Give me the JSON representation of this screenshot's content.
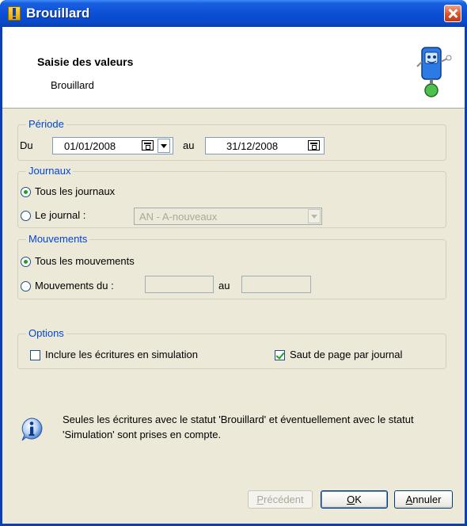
{
  "window": {
    "title": "Brouillard"
  },
  "header": {
    "title": "Saisie des valeurs",
    "subtitle": "Brouillard"
  },
  "periode": {
    "legend": "Période",
    "from_label": "Du",
    "from_value": "01/01/2008",
    "to_label": "au",
    "to_value": "31/12/2008"
  },
  "journaux": {
    "legend": "Journaux",
    "option_all": "Tous les journaux",
    "option_one": "Le journal :",
    "journal_value": "AN - A-nouveaux",
    "selected": "all"
  },
  "mouvements": {
    "legend": "Mouvements",
    "option_all": "Tous les mouvements",
    "option_range": "Mouvements du :",
    "to_label": "au",
    "from_value": "",
    "to_value": "",
    "selected": "all"
  },
  "options": {
    "legend": "Options",
    "include_simulation": "Inclure les écritures en simulation",
    "include_simulation_checked": false,
    "page_break": "Saut de page par journal",
    "page_break_checked": true
  },
  "info": {
    "text": "Seules les écritures avec le statut 'Brouillard' et éventuellement avec le statut 'Simulation' sont prises en compte."
  },
  "buttons": {
    "previous_first": "P",
    "previous_rest": "récédent",
    "ok_first": "O",
    "ok_rest": "K",
    "cancel_first": "A",
    "cancel_rest": "nnuler"
  },
  "icons": {
    "title": "exclamation-icon",
    "close": "close-icon",
    "mascot": "mascot-icon",
    "calendar": "calendar-icon",
    "dropdown": "chevron-down-icon",
    "info": "info-icon"
  },
  "colors": {
    "titlebar": "#0a48c8",
    "legend": "#0046d5",
    "check": "#21a121",
    "dialog_bg": "#ece9d8"
  }
}
